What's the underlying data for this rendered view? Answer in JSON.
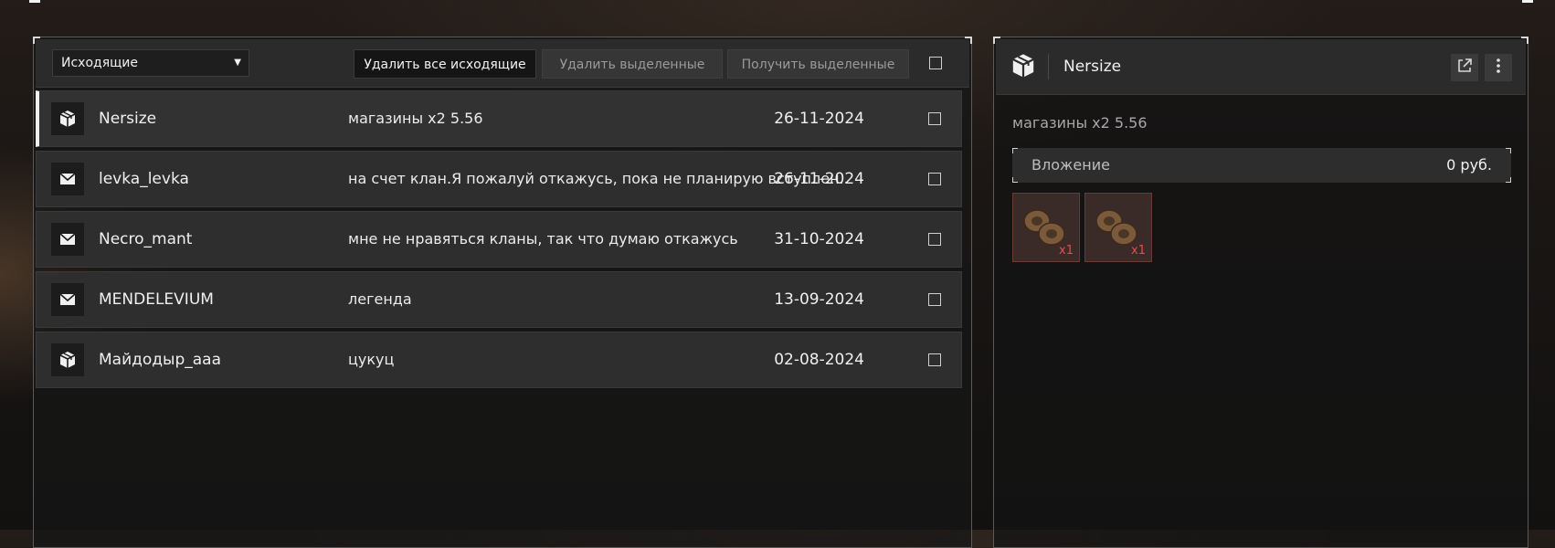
{
  "toolbar": {
    "filter_value": "Исходящие",
    "delete_all_label": "Удалить все исходящие",
    "delete_selected_label": "Удалить выделенные",
    "receive_selected_label": "Получить выделенные"
  },
  "messages": [
    {
      "icon": "package-icon",
      "sender": "Nersize",
      "subject": "магазины x2 5.56",
      "date": "26-11-2024",
      "selected": true
    },
    {
      "icon": "envelope-icon",
      "sender": "levka_levka",
      "subject": "на счет клан.Я пожалуй откажусь, пока не планирую вступлен..",
      "date": "26-11-2024",
      "selected": false
    },
    {
      "icon": "envelope-icon",
      "sender": "Necro_mant",
      "subject": "мне не нравяться кланы, так что думаю откажусь",
      "date": "31-10-2024",
      "selected": false
    },
    {
      "icon": "envelope-icon",
      "sender": "MENDELEVIUM",
      "subject": "легенда",
      "date": "13-09-2024",
      "selected": false
    },
    {
      "icon": "package-icon",
      "sender": "Майдодыр_ааа",
      "subject": "цукуц",
      "date": "02-08-2024",
      "selected": false
    }
  ],
  "detail": {
    "icon": "package-icon",
    "title": "Nersize",
    "subject": "магазины x2 5.56",
    "attachment_label": "Вложение",
    "attachment_value": "0 руб.",
    "items": [
      {
        "icon": "magazine-icon",
        "qty": "x1"
      },
      {
        "icon": "magazine-icon",
        "qty": "x1"
      }
    ]
  },
  "colors": {
    "accent": "#f0f0f0",
    "qty": "#e84c4c",
    "item_border": "#6a3a36"
  }
}
